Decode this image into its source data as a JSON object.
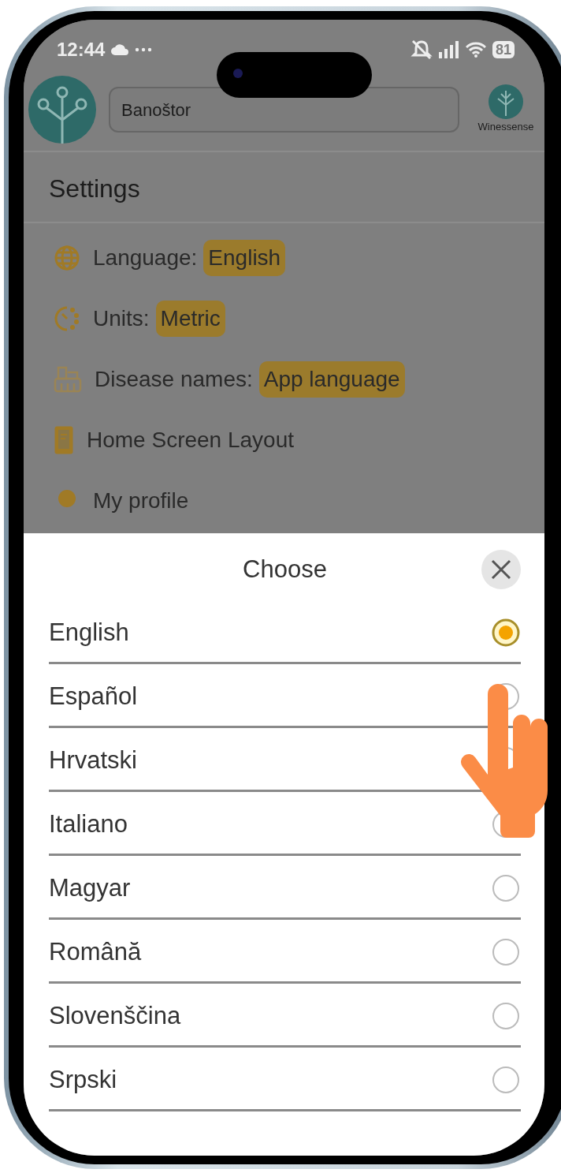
{
  "status_bar": {
    "time": "12:44",
    "battery": "81"
  },
  "header": {
    "location": "Banoštor",
    "brand": "Winessense"
  },
  "page_title": "Settings",
  "settings": [
    {
      "kind": "chip",
      "label": "Language:",
      "value": "English"
    },
    {
      "kind": "chip",
      "label": "Units:",
      "value": "Metric"
    },
    {
      "kind": "chip",
      "label": "Disease names:",
      "value": "App language"
    },
    {
      "kind": "link",
      "label": "Home Screen Layout"
    },
    {
      "kind": "link",
      "label": "My profile"
    }
  ],
  "dialog": {
    "title": "Choose",
    "options": [
      {
        "label": "English",
        "selected": true
      },
      {
        "label": "Español",
        "selected": false
      },
      {
        "label": "Hrvatski",
        "selected": false
      },
      {
        "label": "Italiano",
        "selected": false
      },
      {
        "label": "Magyar",
        "selected": false
      },
      {
        "label": "Română",
        "selected": false
      },
      {
        "label": "Slovenščina",
        "selected": false
      },
      {
        "label": "Srpski",
        "selected": false
      }
    ]
  }
}
